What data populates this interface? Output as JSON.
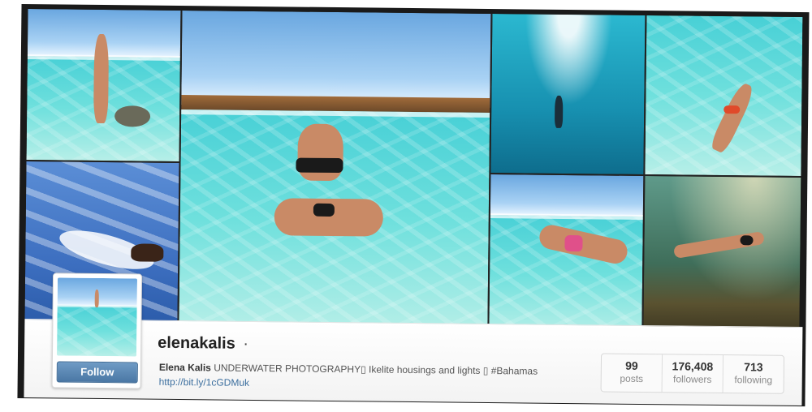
{
  "profile": {
    "username": "elenakalis",
    "verified_mark": "·",
    "full_name": "Elena Kalis",
    "bio": "UNDERWATER PHOTOGRAPHY▯ Ikelite housings and lights ▯ #Bahamas",
    "link": "http://bit.ly/1cGDMuk",
    "follow_label": "Follow"
  },
  "stats": [
    {
      "value": "99",
      "label": "posts"
    },
    {
      "value": "176,408",
      "label": "followers"
    },
    {
      "value": "713",
      "label": "following"
    }
  ],
  "colors": {
    "follow_button": "#4a77a4",
    "link": "#3b6e9e",
    "frame": "#1a1a1a"
  }
}
